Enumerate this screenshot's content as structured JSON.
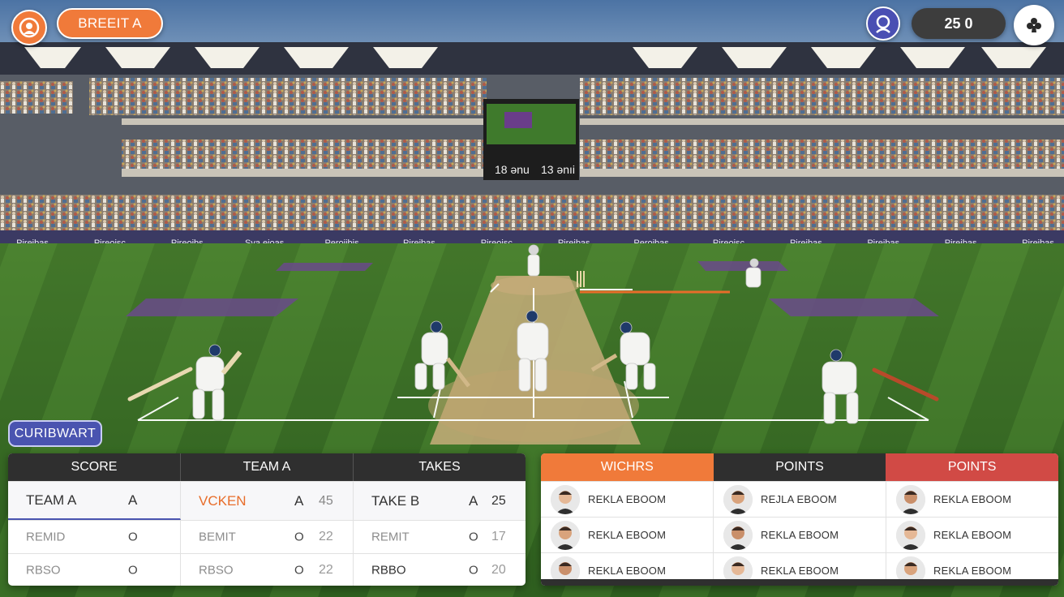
{
  "hud": {
    "mode_label": "BREEIT A",
    "score_value": "25 0"
  },
  "scoreboard_screen": {
    "left": "18 ənu",
    "right": "13 ənıi"
  },
  "ad_boards": [
    "Pireibas",
    "Pireoisc",
    "Pireoibs",
    "Sva eioas",
    "Peroiibis",
    "Pireibas",
    "Pireoisc",
    "Pireibas",
    "Peroibas",
    "Pireoisc",
    "Pireibas",
    "Pireibas",
    "Pireibas",
    "Pireibas"
  ],
  "section_label": "CURIBWART",
  "score_table": {
    "headers": [
      "SCORE",
      "TEAM A",
      "TAKES"
    ],
    "rows": [
      [
        {
          "name": "TEAM A",
          "letter": "A",
          "num": ""
        },
        {
          "name": "VCKEN",
          "letter": "A",
          "num": "45"
        },
        {
          "name": "TAKE B",
          "letter": "A",
          "num": "25"
        }
      ],
      [
        {
          "name": "REMID",
          "letter": "O",
          "num": ""
        },
        {
          "name": "BEMIT",
          "letter": "O",
          "num": "22"
        },
        {
          "name": "REMIT",
          "letter": "O",
          "num": "17"
        }
      ],
      [
        {
          "name": "RBSO",
          "letter": "O",
          "num": ""
        },
        {
          "name": "RBSO",
          "letter": "O",
          "num": "22"
        },
        {
          "name": "RBBO",
          "letter": "O",
          "num": "20"
        }
      ]
    ]
  },
  "leaderboard": {
    "headers": [
      "WICHRS",
      "POINTS",
      "POINTS"
    ],
    "header_colors": [
      "#f07a3a",
      "#2f2f2f",
      "#d14a45"
    ],
    "rows": [
      [
        "REKLA EBOOM",
        "REJLA EBOOM",
        "REKLA EBOOM"
      ],
      [
        "REKLA EBOOM",
        "REKLA EBOOM",
        "REKLA EBOOM"
      ],
      [
        "REKLA EBOOM",
        "REKLA EBOOM",
        "REKLA EBOOM"
      ]
    ]
  },
  "icons": {
    "menu": "club-logo-icon",
    "profile": "profile-icon",
    "settings": "club-suit-icon"
  }
}
